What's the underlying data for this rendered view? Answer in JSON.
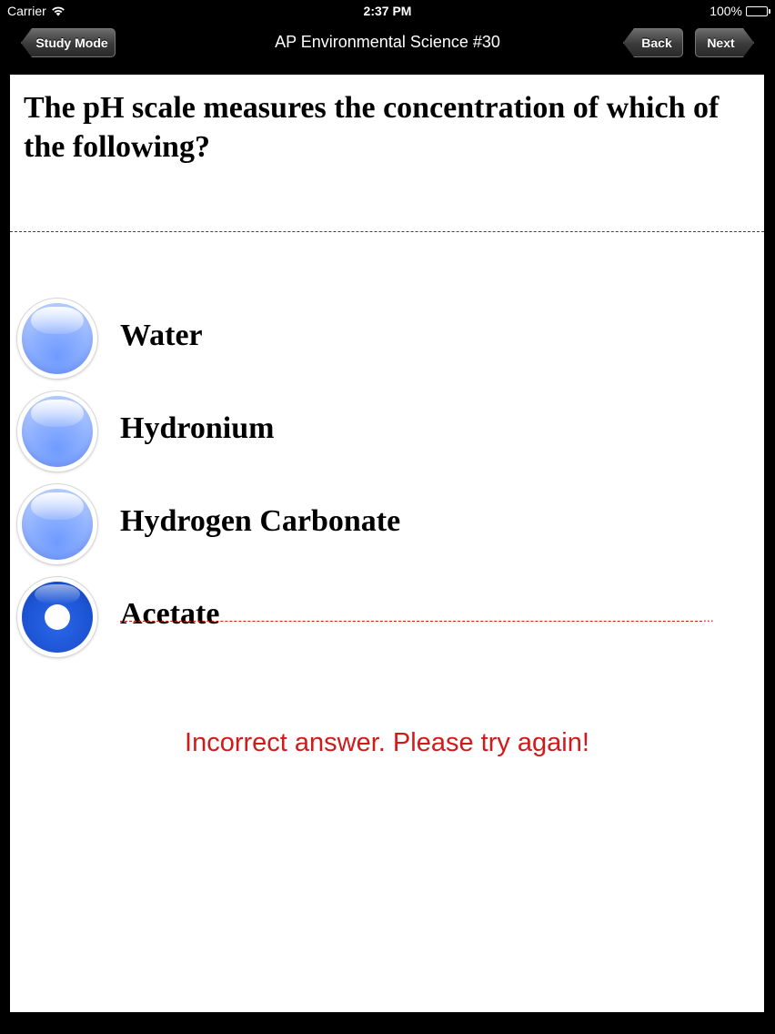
{
  "status_bar": {
    "carrier": "Carrier",
    "wifi_icon": "wifi-icon",
    "time": "2:37 PM",
    "battery_percent": "100%",
    "battery_icon": "battery-icon",
    "battery_level": 1.0
  },
  "nav": {
    "title": "AP Environmental Science #30",
    "study_mode_label": "Study Mode",
    "back_label": "Back",
    "next_label": "Next"
  },
  "question": {
    "text": "The pH scale measures the concentration of which of the following?"
  },
  "options": [
    {
      "label": "Water",
      "selected": false,
      "struck": false
    },
    {
      "label": "Hydronium",
      "selected": false,
      "struck": false
    },
    {
      "label": "Hydrogen Carbonate",
      "selected": false,
      "struck": false
    },
    {
      "label": "Acetate",
      "selected": true,
      "struck": true
    }
  ],
  "strike_tail": "...",
  "feedback": {
    "text": "Incorrect answer. Please try again!",
    "color": "#d11a1a"
  },
  "colors": {
    "radio_unselected": "#8fb1ff",
    "radio_selected": "#1d56d6",
    "nav_background": "#000000",
    "card_background": "#ffffff"
  }
}
